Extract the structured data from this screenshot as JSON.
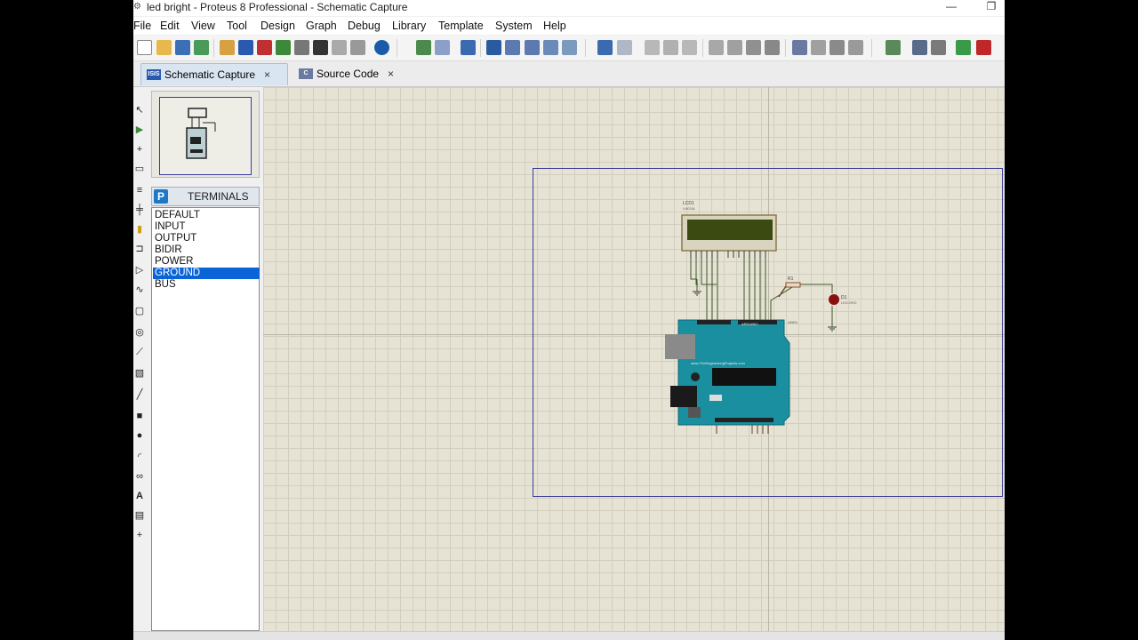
{
  "window": {
    "title": "led bright - Proteus 8 Professional - Schematic Capture"
  },
  "menu": {
    "items": [
      "File",
      "Edit",
      "View",
      "Tool",
      "Design",
      "Graph",
      "Debug",
      "Library",
      "Template",
      "System",
      "Help"
    ]
  },
  "tabs": [
    {
      "label": "Schematic Capture",
      "icon": "isis-icon",
      "close": "×"
    },
    {
      "label": "Source Code",
      "icon": "code-icon",
      "close": "×"
    }
  ],
  "device_selector": {
    "mode_button": "P",
    "title": "TERMINALS",
    "items": [
      "DEFAULT",
      "INPUT",
      "OUTPUT",
      "BIDIR",
      "POWER",
      "GROUND",
      "BUS"
    ],
    "selected": "GROUND"
  },
  "colors": {
    "canvas_bg": "#e6e3d5",
    "sheet_border": "#3b3b9a",
    "selection_blue": "#0a64d8",
    "arduino_teal": "#1a8fa0",
    "lcd_green": "#3b4a10",
    "led_red": "#8a1010"
  }
}
